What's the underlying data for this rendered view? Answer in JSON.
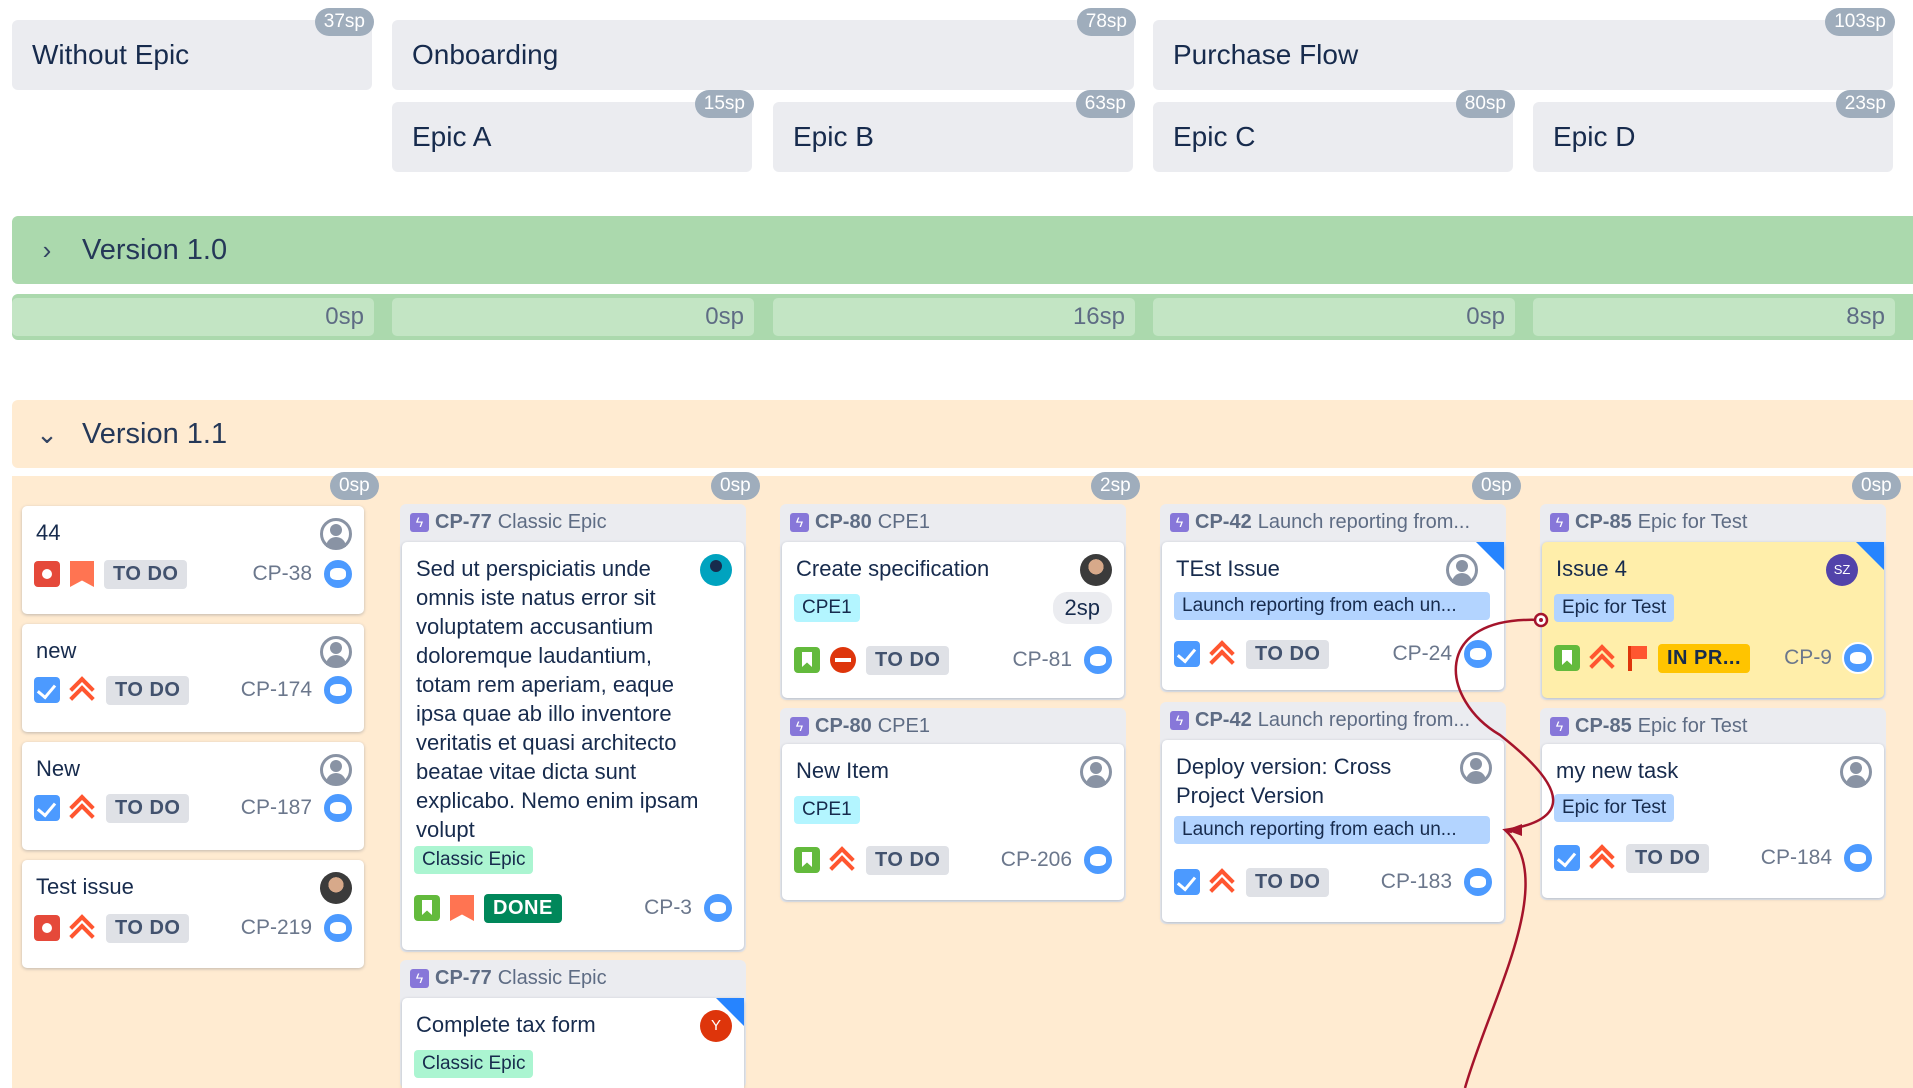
{
  "epics_row": [
    {
      "name": "Without Epic",
      "sp": "37sp"
    },
    {
      "name": "Onboarding",
      "sp": "78sp"
    },
    {
      "name": "Purchase Flow",
      "sp": "103sp"
    },
    {
      "name": "Epic A",
      "sp": "15sp"
    },
    {
      "name": "Epic B",
      "sp": "63sp"
    },
    {
      "name": "Epic C",
      "sp": "80sp"
    },
    {
      "name": "Epic D",
      "sp": "23sp"
    }
  ],
  "versions": [
    {
      "name": "Version 1.0",
      "chevron": "›",
      "column_sp": [
        "0sp",
        "0sp",
        "16sp",
        "0sp",
        "8sp"
      ]
    },
    {
      "name": "Version 1.1",
      "chevron": "⌄",
      "column_sp": [
        "0sp",
        "0sp",
        "2sp",
        "0sp",
        "0sp"
      ]
    }
  ],
  "columns": {
    "col0": {
      "cards": [
        {
          "title": "44",
          "status": "TO DO",
          "key": "CP-38",
          "type": "bug",
          "priority": "blocker"
        },
        {
          "title": "new",
          "status": "TO DO",
          "key": "CP-174",
          "type": "task",
          "priority": "highest"
        },
        {
          "title": "New",
          "status": "TO DO",
          "key": "CP-187",
          "type": "task",
          "priority": "highest"
        },
        {
          "title": "Test issue",
          "status": "TO DO",
          "key": "CP-219",
          "type": "bug",
          "priority": "highest"
        }
      ]
    },
    "col1": {
      "groups": [
        {
          "header_key": "CP-77",
          "header_name": "Classic Epic",
          "title": "Sed ut perspiciatis unde omnis iste natus error sit voluptatem accusantium doloremque laudantium, totam rem aperiam, eaque ipsa quae ab illo inventore veritatis et quasi architecto beatae vitae dicta sunt explicabo. Nemo enim ipsam volupt",
          "label": "Classic Epic",
          "status": "DONE",
          "key": "CP-3"
        },
        {
          "header_key": "CP-77",
          "header_name": "Classic Epic",
          "title": "Complete tax form",
          "label": "Classic Epic",
          "avatar_letter": "Y"
        }
      ]
    },
    "col2": {
      "groups": [
        {
          "header_key": "CP-80",
          "header_name": "CPE1",
          "title": "Create specification",
          "label": "CPE1",
          "sp": "2sp",
          "status": "TO DO",
          "key": "CP-81"
        },
        {
          "header_key": "CP-80",
          "header_name": "CPE1",
          "title": "New Item",
          "label": "CPE1",
          "status": "TO DO",
          "key": "CP-206"
        }
      ]
    },
    "col3": {
      "groups": [
        {
          "header_key": "CP-42",
          "header_name": "Launch reporting from...",
          "title": "TEst Issue",
          "label": "Launch reporting from each un...",
          "status": "TO DO",
          "key": "CP-24"
        },
        {
          "header_key": "CP-42",
          "header_name": "Launch reporting from...",
          "title": "Deploy version: Cross Project Version",
          "label": "Launch reporting from each un...",
          "status": "TO DO",
          "key": "CP-183"
        }
      ]
    },
    "col4": {
      "groups": [
        {
          "header_key": "CP-85",
          "header_name": "Epic for Test",
          "title": "Issue 4",
          "label": "Epic for Test",
          "status": "IN PR...",
          "key": "CP-9",
          "avatar_initials": "SZ"
        },
        {
          "header_key": "CP-85",
          "header_name": "Epic for Test",
          "title": "my new task",
          "label": "Epic for Test",
          "status": "TO DO",
          "key": "CP-184"
        }
      ]
    }
  },
  "colors": {
    "version_1_0": "#abd9ad",
    "version_1_1": "#ffebd1",
    "dependency_arrow": "#a5142b"
  }
}
